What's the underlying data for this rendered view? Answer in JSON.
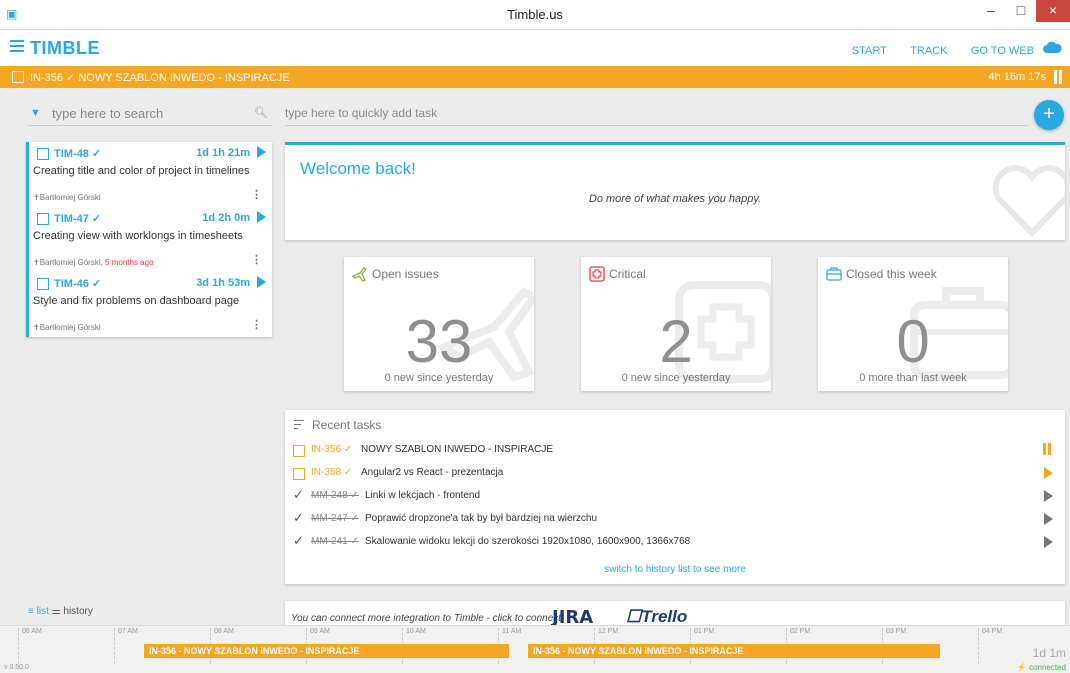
{
  "window": {
    "title": "Timble.us",
    "minimize": "–",
    "maximize": "□",
    "close": "×"
  },
  "header": {
    "brand": "TIMBLE",
    "nav": [
      "START",
      "TRACK",
      "GO TO WEB"
    ]
  },
  "active_task": {
    "label": "IN-356 ✓ NOWY SZABLON INWEDO - INSPIRACJE",
    "time": "4h 16m 17s"
  },
  "search": {
    "placeholder": "type here to search"
  },
  "quick_add": {
    "placeholder": "type here to quickly add task",
    "button": "+"
  },
  "tasks": [
    {
      "id": "TIM-48 ✓",
      "time": "1d 1h 21m",
      "desc": "Creating title and color of project in timelines",
      "user": "Bartłomiej Górski",
      "ago": ""
    },
    {
      "id": "TIM-47 ✓",
      "time": "1d 2h 0m",
      "desc": "Creating view with worklongs in timesheets",
      "user": "Bartłomiej Górski",
      "ago": ", 5 months ago"
    },
    {
      "id": "TIM-46 ✓",
      "time": "3d 1h 53m",
      "desc": "Style and fix problems on dashboard page",
      "user": "Bartłomiej Górski",
      "ago": ""
    }
  ],
  "welcome": {
    "title": "Welcome back!",
    "subtitle": "Do more of what makes you happy."
  },
  "stats": [
    {
      "title": "Open issues",
      "value": "33",
      "sub": "0 new since yesterday",
      "icon": "plane-icon"
    },
    {
      "title": "Critical",
      "value": "2",
      "sub": "0 new since yesterday",
      "icon": "medical-icon"
    },
    {
      "title": "Closed this week",
      "value": "0",
      "sub": "0 more than last week",
      "icon": "briefcase-icon"
    }
  ],
  "recent": {
    "title": "Recent tasks",
    "rows": [
      {
        "id": "IN-356 ✓",
        "desc": "NOWY SZABLON INWEDO - INSPIRACJE",
        "done": false,
        "state": "pause"
      },
      {
        "id": "IN-358 ✓",
        "desc": "Angular2 vs React - prezentacja",
        "done": false,
        "state": "play-orange"
      },
      {
        "id": "MM-248 ✓",
        "desc": "Linki w lekcjach - frontend",
        "done": true,
        "state": "play"
      },
      {
        "id": "MM-247 ✓",
        "desc": "Poprawić dropzone'a tak by był bardziej na wierzchu",
        "done": true,
        "state": "play"
      },
      {
        "id": "MM-241 ✓",
        "desc": "Skalowanie widoku lekcji do szerokości 1920x1080, 1600x900, 1366x768",
        "done": true,
        "state": "play"
      }
    ],
    "more": "switch to history list to see more"
  },
  "view_toggle": {
    "list": "list",
    "history": "history"
  },
  "integration": {
    "text": "You can connect more integration to Timble - click to connect:",
    "jira": "JIRA",
    "trello": "Trello"
  },
  "timeline": {
    "ticks": [
      "06 AM",
      "07 AM",
      "08 AM",
      "09 AM",
      "10 AM",
      "11 AM",
      "12 PM",
      "01 PM",
      "02 PM",
      "03 PM",
      "04 PM"
    ],
    "segments": [
      "IN-356 - NOWY SZABLON INWEDO - INSPIRACJE",
      "IN-356 - NOWY SZABLON INWEDO - INSPIRACJE"
    ],
    "version": "v 0.50.0",
    "total": "1d 1m",
    "status": "connected"
  },
  "colors": {
    "accent": "#2aa9e0",
    "orange": "#f5a623",
    "critical": "#e53935"
  }
}
